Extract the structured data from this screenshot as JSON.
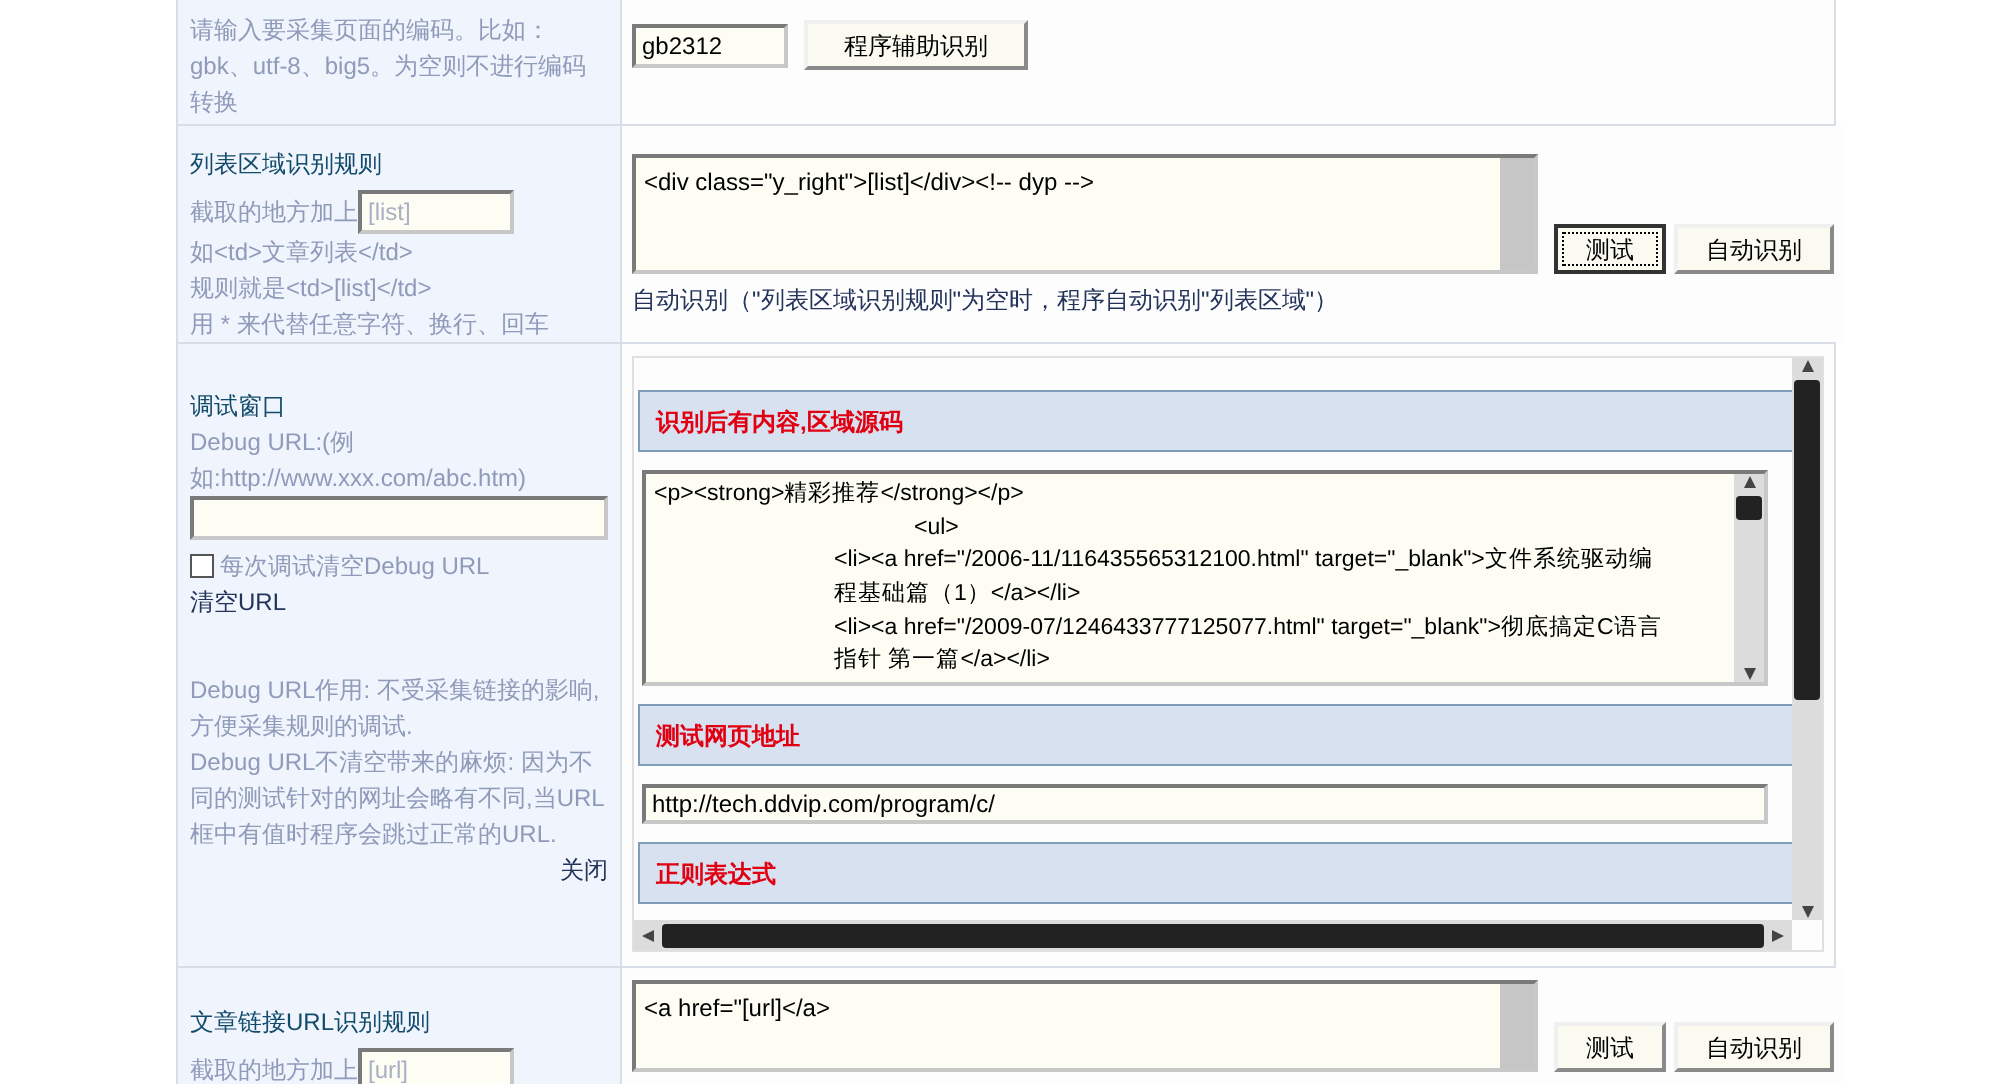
{
  "encoding_row": {
    "hint": "请输入要采集页面的编码。比如：gbk、utf-8、big5。为空则不进行编码转换",
    "input": {
      "value": "gb2312"
    },
    "button": "程序辅助识别"
  },
  "list_rule_row": {
    "title": "列表区域识别规则",
    "hint_prefix": "截取的地方加上",
    "tag_field": {
      "placeholder": "[list]"
    },
    "hint_lines": [
      "如<td>文章列表</td>",
      "规则就是<td>[list]</td>",
      "用 * 来代替任意字符、换行、回车"
    ],
    "textarea": {
      "value": "<div class=\"y_right\">[list]</div><!-- dyp -->"
    },
    "buttons": [
      {
        "label": "测试",
        "focused": true
      },
      {
        "label": "自动识别",
        "focused": false
      }
    ],
    "note_link": "自动识别",
    "note": "（\"列表区域识别规则\"为空时，程序自动识别\"列表区域\"）"
  },
  "debug_row": {
    "title": "调试窗口",
    "url_label": "Debug URL:(例如:http://www.xxx.com/abc.htm)",
    "clear_each": {
      "label": "每次调试清空Debug URL",
      "checked": false
    },
    "clear_link": "清空URL",
    "notes": [
      "Debug URL作用: 不受采集链接的影响,方便采集规则的调试.",
      "Debug URL不清空带来的麻烦: 因为不同的测试针对的网址会略有不同,当URL框中有值时程序会跳过正常的URL."
    ],
    "close_link": "关闭",
    "panel": [
      {
        "kind": "header",
        "text": "识别后有内容,区域源码"
      },
      {
        "kind": "code",
        "lines": [
          {
            "kind": "plain",
            "text": "<p><strong>精彩推荐</strong></p>"
          },
          {
            "kind": "deep",
            "text": "<ul>"
          },
          {
            "kind": "item",
            "text": "<li><a href=\"/2006-11/116435565312100.html\" target=\"_blank\">文件系统驱动编程基础篇（1）</a></li>"
          },
          {
            "kind": "item",
            "text": "<li><a href=\"/2009-07/1246433777125077.html\" target=\"_blank\">彻底搞定C语言指针 第一篇</a></li>"
          }
        ]
      },
      {
        "kind": "header",
        "text": "测试网页地址"
      },
      {
        "kind": "input",
        "value": "http://tech.ddvip.com/program/c/"
      },
      {
        "kind": "header",
        "text": "正则表达式"
      },
      {
        "kind": "stub"
      }
    ]
  },
  "link_rule_row": {
    "title": "文章链接URL识别规则",
    "hint_prefix": "截取的地方加上",
    "tag_field": {
      "placeholder": "[url]"
    },
    "textarea": {
      "value": "<a href=\"[url]</a>"
    },
    "buttons": [
      {
        "label": "测试",
        "focused": false
      },
      {
        "label": "自动识别",
        "focused": false
      }
    ]
  }
}
